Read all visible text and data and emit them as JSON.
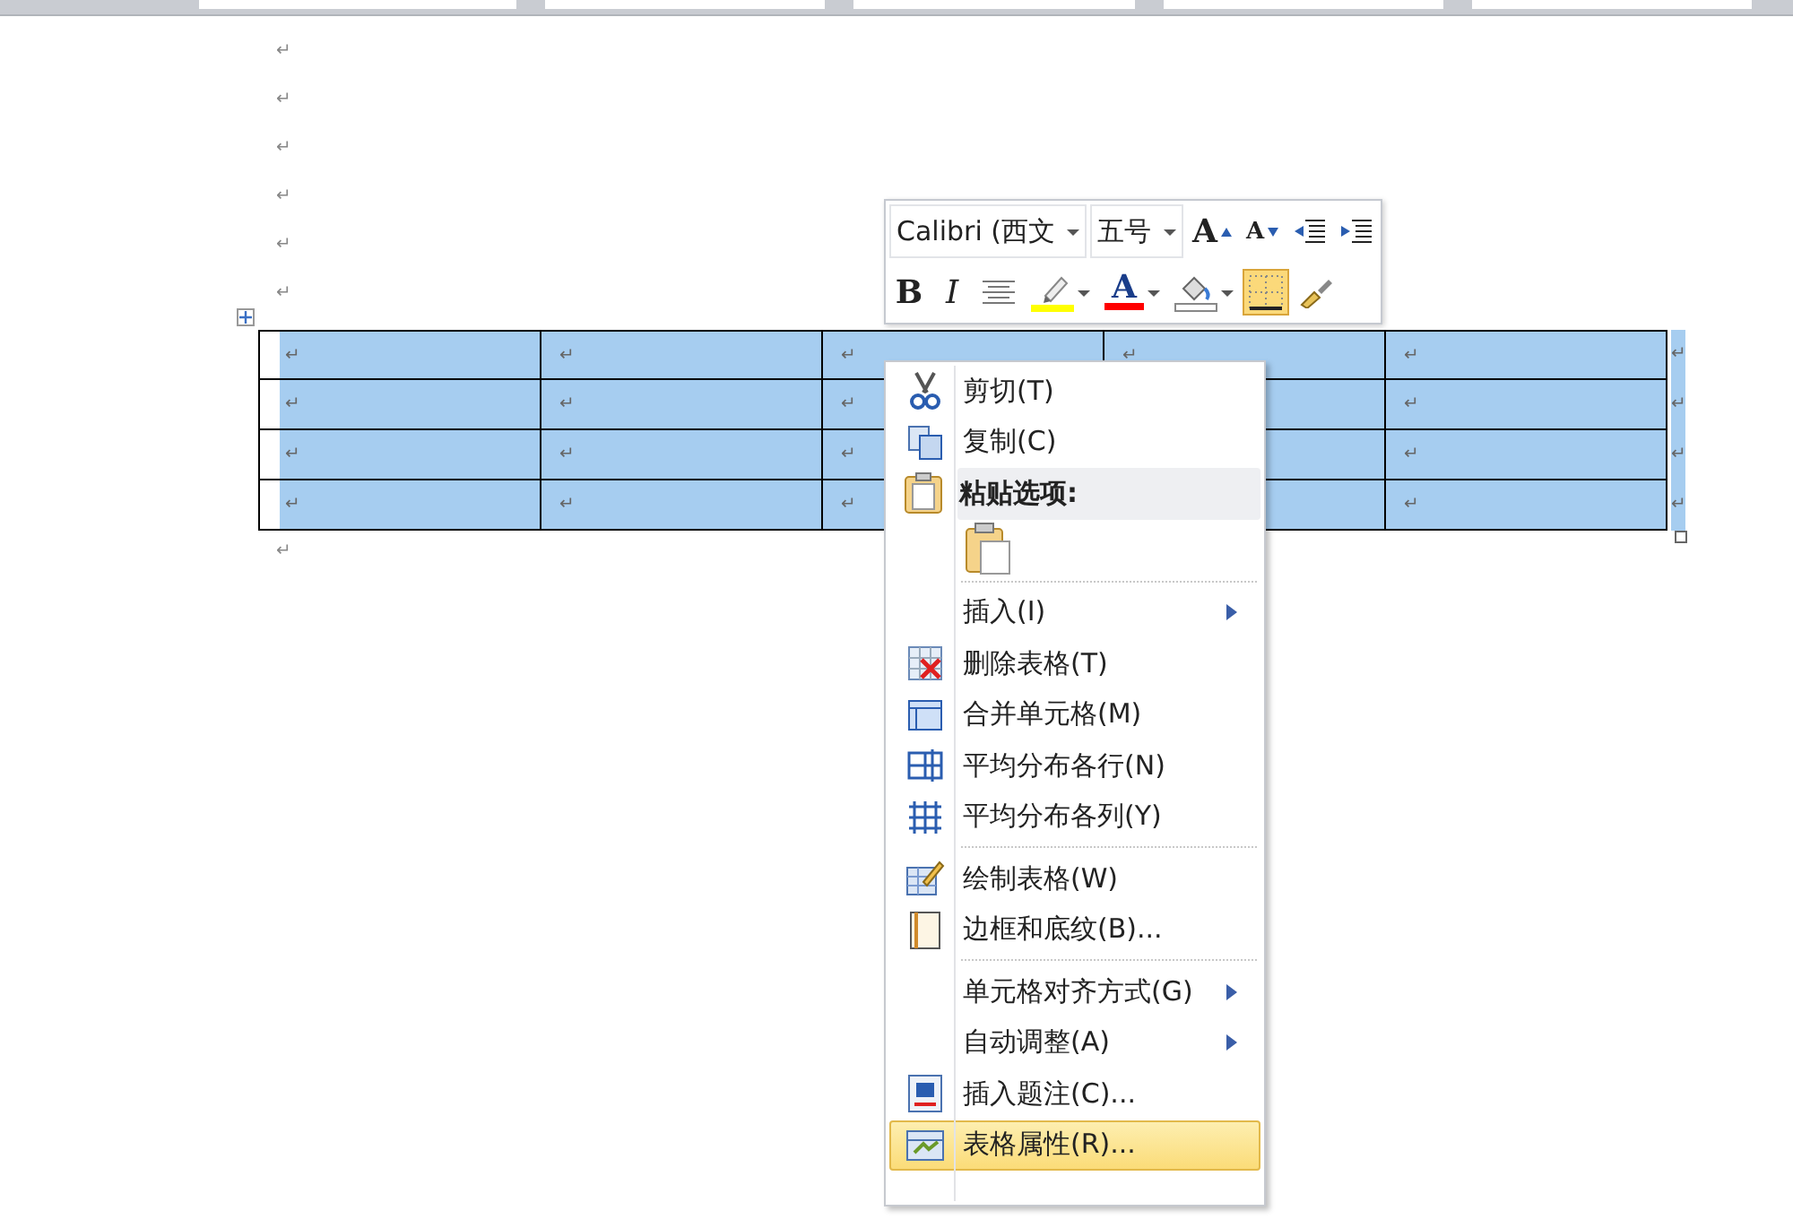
{
  "document": {
    "paragraph_marks_before": [
      "↵",
      "↵",
      "↵",
      "↵",
      "↵",
      "↵"
    ],
    "table": {
      "selected": true,
      "rows": [
        {
          "cells": [
            "↵",
            "↵",
            "↵",
            "↵",
            "↵"
          ],
          "end": "↵"
        },
        {
          "cells": [
            "↵",
            "↵",
            "↵",
            null,
            "↵"
          ],
          "end": "↵"
        },
        {
          "cells": [
            "↵",
            "↵",
            "↵",
            null,
            "↵"
          ],
          "end": "↵"
        },
        {
          "cells": [
            "↵",
            "↵",
            "↵",
            null,
            "↵"
          ],
          "end": "↵"
        }
      ]
    },
    "paragraph_marks_after": [
      "↵"
    ]
  },
  "mini_toolbar": {
    "font": {
      "value": "Calibri (西文"
    },
    "size": {
      "value": "五号"
    },
    "buttons": [
      {
        "kind": "grow",
        "label": "A",
        "selected": false
      },
      {
        "kind": "shrink",
        "label": "A",
        "selected": false
      },
      {
        "kind": "outdent",
        "selected": false
      },
      {
        "kind": "indent",
        "selected": false
      },
      {
        "kind": "bold",
        "label": "B",
        "selected": false
      },
      {
        "kind": "italic",
        "label": "I",
        "selected": false
      },
      {
        "kind": "center",
        "selected": false
      },
      {
        "kind": "highlight",
        "selected": false,
        "color": "#ffff00"
      },
      {
        "kind": "fontcolor",
        "label": "A",
        "selected": false,
        "color": "#ff0000"
      },
      {
        "kind": "shading",
        "selected": false,
        "color": "#ffffff"
      },
      {
        "kind": "borders",
        "selected": true
      },
      {
        "kind": "painter",
        "selected": false
      }
    ]
  },
  "context_menu": {
    "items": [
      {
        "kind": "item",
        "label": "剪切(T)",
        "selected": false,
        "submenu": false
      },
      {
        "kind": "item",
        "label": "复制(C)",
        "selected": false,
        "submenu": false
      },
      {
        "kind": "header",
        "label": "粘贴选项:"
      },
      {
        "kind": "paste"
      },
      {
        "kind": "separator"
      },
      {
        "kind": "item",
        "label": "插入(I)",
        "selected": false,
        "submenu": true
      },
      {
        "kind": "item",
        "label": "删除表格(T)",
        "selected": false,
        "submenu": false
      },
      {
        "kind": "item",
        "label": "合并单元格(M)",
        "selected": false,
        "submenu": false
      },
      {
        "kind": "item",
        "label": "平均分布各行(N)",
        "selected": false,
        "submenu": false
      },
      {
        "kind": "item",
        "label": "平均分布各列(Y)",
        "selected": false,
        "submenu": false
      },
      {
        "kind": "separator"
      },
      {
        "kind": "item",
        "label": "绘制表格(W)",
        "selected": false,
        "submenu": false
      },
      {
        "kind": "item",
        "label": "边框和底纹(B)...",
        "selected": false,
        "submenu": false
      },
      {
        "kind": "separator"
      },
      {
        "kind": "item",
        "label": "单元格对齐方式(G)",
        "selected": false,
        "submenu": true
      },
      {
        "kind": "item",
        "label": "自动调整(A)",
        "selected": false,
        "submenu": true
      },
      {
        "kind": "item",
        "label": "插入题注(C)...",
        "selected": false,
        "submenu": false
      },
      {
        "kind": "item",
        "label": "表格属性(R)...",
        "selected": true,
        "submenu": false
      }
    ]
  }
}
